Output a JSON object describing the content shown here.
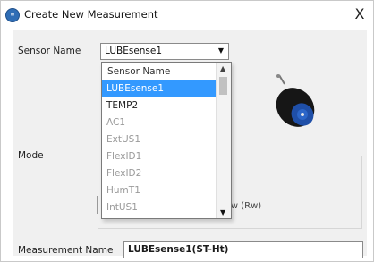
{
  "window": {
    "title": "Create New Measurement",
    "close_glyph": "X"
  },
  "form": {
    "sensor_name_label": "Sensor Name",
    "sensor_name_value": "LUBEsense1",
    "mode_label": "Mode",
    "raw_label": "Raw (Rw)",
    "measurement_name_label": "Measurement Name",
    "measurement_name_value": "LUBEsense1(ST-Ht)"
  },
  "dropdown": {
    "header": "Sensor Name",
    "items": [
      {
        "label": "LUBEsense1",
        "state": "selected"
      },
      {
        "label": "TEMP2",
        "state": "normal"
      },
      {
        "label": "AC1",
        "state": "disabled"
      },
      {
        "label": "ExtUS1",
        "state": "disabled"
      },
      {
        "label": "FlexID1",
        "state": "disabled"
      },
      {
        "label": "FlexID2",
        "state": "disabled"
      },
      {
        "label": "HumT1",
        "state": "disabled"
      },
      {
        "label": "IntUS1",
        "state": "disabled"
      }
    ]
  },
  "icons": {
    "app": "app-logo-icon",
    "sensor": "sensor-device-icon",
    "dropdown_arrow": "chevron-down-icon"
  },
  "colors": {
    "selection": "#3399ff",
    "sensor_body": "#1a1a1a",
    "sensor_face": "#1f4fa8"
  }
}
